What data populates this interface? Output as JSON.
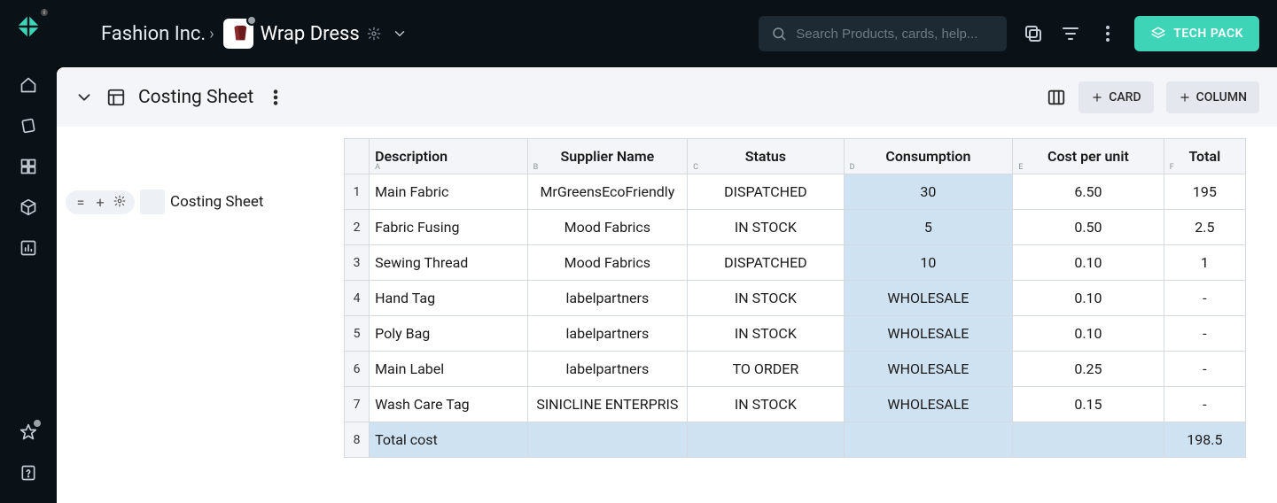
{
  "breadcrumb": {
    "org": "Fashion Inc."
  },
  "product": {
    "title": "Wrap Dress"
  },
  "search": {
    "placeholder": "Search Products, cards, help..."
  },
  "header_buttons": {
    "tech_pack": "TECH PACK",
    "card": "CARD",
    "column": "COLUMN"
  },
  "sheet": {
    "title": "Costing Sheet"
  },
  "tree": {
    "item_label": "Costing Sheet"
  },
  "columns": [
    {
      "letter": "A",
      "label": "Description"
    },
    {
      "letter": "B",
      "label": "Supplier Name"
    },
    {
      "letter": "C",
      "label": "Status"
    },
    {
      "letter": "D",
      "label": "Consumption"
    },
    {
      "letter": "E",
      "label": "Cost per unit"
    },
    {
      "letter": "F",
      "label": "Total"
    }
  ],
  "rows": [
    {
      "n": "1",
      "desc": "Main Fabric",
      "supplier": "MrGreensEcoFriendly",
      "status": "DISPATCHED",
      "consumption": "30",
      "cost": "6.50",
      "total": "195"
    },
    {
      "n": "2",
      "desc": "Fabric Fusing",
      "supplier": "Mood Fabrics",
      "status": "IN STOCK",
      "consumption": "5",
      "cost": "0.50",
      "total": "2.5"
    },
    {
      "n": "3",
      "desc": "Sewing Thread",
      "supplier": "Mood Fabrics",
      "status": "DISPATCHED",
      "consumption": "10",
      "cost": "0.10",
      "total": "1"
    },
    {
      "n": "4",
      "desc": "Hand Tag",
      "supplier": "labelpartners",
      "status": "IN STOCK",
      "consumption": "WHOLESALE",
      "cost": "0.10",
      "total": "-"
    },
    {
      "n": "5",
      "desc": "Poly Bag",
      "supplier": "labelpartners",
      "status": "IN STOCK",
      "consumption": "WHOLESALE",
      "cost": "0.10",
      "total": "-"
    },
    {
      "n": "6",
      "desc": "Main Label",
      "supplier": "labelpartners",
      "status": "TO ORDER",
      "consumption": "WHOLESALE",
      "cost": "0.25",
      "total": "-"
    },
    {
      "n": "7",
      "desc": "Wash Care Tag",
      "supplier": "SINICLINE ENTERPRIS",
      "status": "IN STOCK",
      "consumption": "WHOLESALE",
      "cost": "0.15",
      "total": "-"
    }
  ],
  "total_row": {
    "n": "8",
    "label": "Total cost",
    "value": "198.5"
  }
}
